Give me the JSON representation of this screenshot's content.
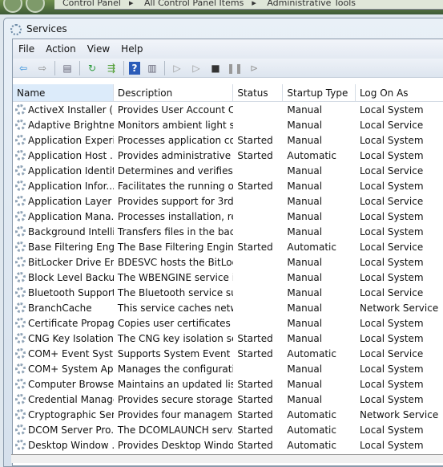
{
  "breadcrumb": [
    "Control Panel",
    "All Control Panel Items",
    "Administrative Tools"
  ],
  "window": {
    "title": "Services"
  },
  "menu": [
    "File",
    "Action",
    "View",
    "Help"
  ],
  "toolbar": [
    {
      "icon": "back-arrow-icon",
      "glyph": "⇦",
      "color": "#2a8ad8"
    },
    {
      "icon": "forward-arrow-icon",
      "glyph": "⇨",
      "color": "#888"
    },
    {
      "icon": "console-tree-icon",
      "glyph": "▤",
      "color": "#667"
    },
    {
      "icon": "refresh-icon",
      "glyph": "↻",
      "color": "#2a9a3a"
    },
    {
      "icon": "export-list-icon",
      "glyph": "⇶",
      "color": "#4a9a2a"
    },
    {
      "icon": "help-icon",
      "glyph": "?",
      "color": "#fff"
    },
    {
      "icon": "action-pane-icon",
      "glyph": "▥",
      "color": "#667"
    },
    {
      "icon": "start-icon",
      "glyph": "▷",
      "color": "#999"
    },
    {
      "icon": "start-paused-icon",
      "glyph": "▷",
      "color": "#999"
    },
    {
      "icon": "stop-icon",
      "glyph": "■",
      "color": "#333"
    },
    {
      "icon": "pause-icon",
      "glyph": "❚❚",
      "color": "#999"
    },
    {
      "icon": "restart-icon",
      "glyph": "⊳",
      "color": "#999"
    }
  ],
  "columns": [
    "Name",
    "Description",
    "Status",
    "Startup Type",
    "Log On As"
  ],
  "rows": [
    [
      "ActiveX Installer (...",
      "Provides User Account C...",
      "",
      "Manual",
      "Local System"
    ],
    [
      "Adaptive Brightness",
      "Monitors ambient light s...",
      "",
      "Manual",
      "Local Service"
    ],
    [
      "Application Experi...",
      "Processes application co...",
      "Started",
      "Manual",
      "Local System"
    ],
    [
      "Application Host ...",
      "Provides administrative s...",
      "Started",
      "Automatic",
      "Local System"
    ],
    [
      "Application Identity",
      "Determines and verifies t...",
      "",
      "Manual",
      "Local Service"
    ],
    [
      "Application Infor...",
      "Facilitates the running of...",
      "Started",
      "Manual",
      "Local System"
    ],
    [
      "Application Layer ...",
      "Provides support for 3rd ...",
      "",
      "Manual",
      "Local Service"
    ],
    [
      "Application Mana...",
      "Processes installation, re...",
      "",
      "Manual",
      "Local System"
    ],
    [
      "Background Intelli...",
      "Transfers files in the bac...",
      "",
      "Manual",
      "Local System"
    ],
    [
      "Base Filtering Engi...",
      "The Base Filtering Engine...",
      "Started",
      "Automatic",
      "Local Service"
    ],
    [
      "BitLocker Drive En...",
      "BDESVC hosts the BitLoc...",
      "",
      "Manual",
      "Local System"
    ],
    [
      "Block Level Backu...",
      "The WBENGINE service is...",
      "",
      "Manual",
      "Local System"
    ],
    [
      "Bluetooth Support...",
      "The Bluetooth service su...",
      "",
      "Manual",
      "Local Service"
    ],
    [
      "BranchCache",
      "This service caches netw...",
      "",
      "Manual",
      "Network Service"
    ],
    [
      "Certificate Propag...",
      "Copies user certificates a...",
      "",
      "Manual",
      "Local System"
    ],
    [
      "CNG Key Isolation",
      "The CNG key isolation se...",
      "Started",
      "Manual",
      "Local System"
    ],
    [
      "COM+ Event Syst...",
      "Supports System Event N...",
      "Started",
      "Automatic",
      "Local Service"
    ],
    [
      "COM+ System Ap...",
      "Manages the configurati...",
      "",
      "Manual",
      "Local System"
    ],
    [
      "Computer Browser",
      "Maintains an updated lis...",
      "Started",
      "Manual",
      "Local System"
    ],
    [
      "Credential Manager",
      "Provides secure storage ...",
      "Started",
      "Manual",
      "Local System"
    ],
    [
      "Cryptographic Ser...",
      "Provides four managem...",
      "Started",
      "Automatic",
      "Network Service"
    ],
    [
      "DCOM Server Pro...",
      "The DCOMLAUNCH serv...",
      "Started",
      "Automatic",
      "Local System"
    ],
    [
      "Desktop Window ...",
      "Provides Desktop Windo...",
      "Started",
      "Automatic",
      "Local System"
    ]
  ]
}
